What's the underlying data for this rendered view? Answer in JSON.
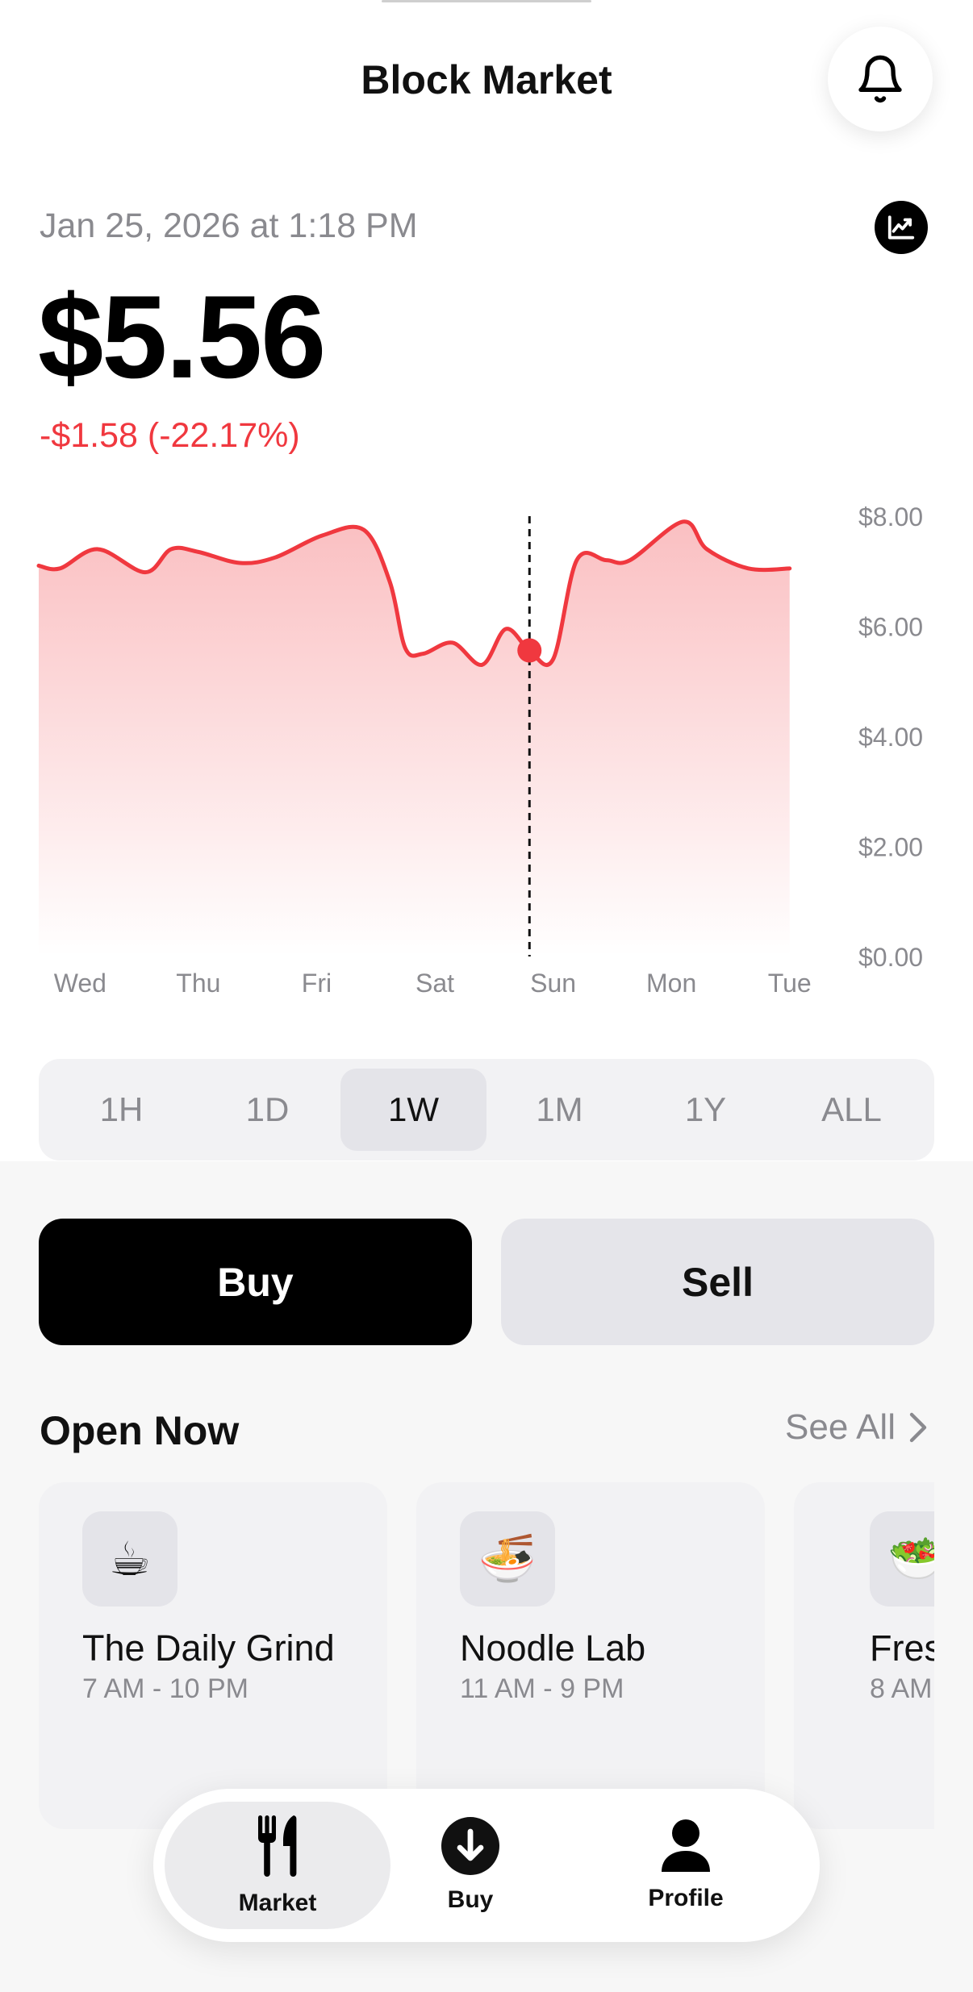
{
  "header": {
    "title": "Block Market",
    "bell_icon": "bell-icon"
  },
  "quote": {
    "timestamp": "Jan 25, 2026 at 1:18 PM",
    "price": "$5.56",
    "change": "-$1.58 (-22.17%)",
    "chart_type_icon": "line-chart-icon",
    "negative_color": "#f0383f"
  },
  "chart_data": {
    "type": "area",
    "x_tick_labels": [
      "Wed",
      "Thu",
      "Fri",
      "Sat",
      "Sun",
      "Mon",
      "Tue"
    ],
    "y_tick_labels": [
      "$8.00",
      "$6.00",
      "$4.00",
      "$2.00",
      "$0.00"
    ],
    "ylim": [
      0,
      8
    ],
    "grid": false,
    "x": [
      0,
      0.18,
      0.5,
      0.9,
      1.12,
      1.35,
      1.7,
      2.0,
      2.4,
      2.75,
      2.97,
      3.1,
      3.25,
      3.5,
      3.75,
      3.95,
      4.15,
      4.35,
      4.55,
      4.8,
      5.0,
      5.45,
      5.65,
      6.0,
      6.35
    ],
    "values": [
      7.1,
      7.05,
      7.4,
      6.98,
      7.4,
      7.35,
      7.15,
      7.25,
      7.65,
      7.75,
      6.8,
      5.6,
      5.5,
      5.7,
      5.3,
      5.95,
      5.56,
      5.4,
      7.2,
      7.2,
      7.2,
      7.9,
      7.4,
      7.05,
      7.05
    ],
    "selected_index": 16,
    "selected_label": "Sun",
    "selected_value": 5.56,
    "line_color": "#f0383f",
    "fill_color": "#f0383f"
  },
  "ranges": {
    "items": [
      "1H",
      "1D",
      "1W",
      "1M",
      "1Y",
      "ALL"
    ],
    "selected": "1W"
  },
  "actions": {
    "buy": "Buy",
    "sell": "Sell"
  },
  "open_now": {
    "title": "Open Now",
    "see_all": "See All",
    "see_all_icon": "chevron-right-icon",
    "cards": [
      {
        "emoji": "☕",
        "name": "The Daily Grind",
        "hours": "7 AM - 10 PM"
      },
      {
        "emoji": "🍜",
        "name": "Noodle Lab",
        "hours": "11 AM - 9 PM"
      },
      {
        "emoji": "🥗",
        "name": "Fres",
        "hours": "8 AM"
      }
    ]
  },
  "tabbar": {
    "tabs": [
      {
        "label": "Market",
        "icon": "fork-knife-icon",
        "active": true
      },
      {
        "label": "Buy",
        "icon": "download-circle-icon",
        "active": false
      },
      {
        "label": "Profile",
        "icon": "person-icon",
        "active": false
      }
    ]
  }
}
